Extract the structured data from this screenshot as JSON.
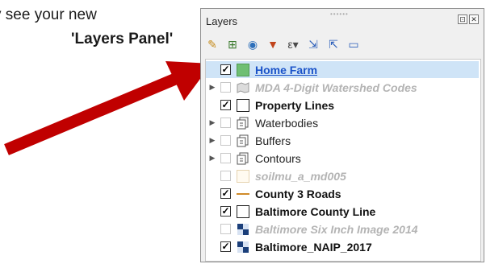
{
  "captions": {
    "line1": "y see your new",
    "line2": "'Layers Panel'"
  },
  "panel": {
    "title": "Layers",
    "titlebar_buttons": [
      "⊡",
      "✕"
    ],
    "toolbar": [
      {
        "icon": "paintbrush-icon",
        "glyph": "✎",
        "color": "#c58a18"
      },
      {
        "icon": "add-group-icon",
        "glyph": "⊞",
        "color": "#3a7a2c"
      },
      {
        "icon": "eye-icon",
        "glyph": "◉",
        "color": "#2d6fba"
      },
      {
        "icon": "filter-icon",
        "glyph": "▼",
        "color": "#c1441b"
      },
      {
        "icon": "filter-expression-icon",
        "glyph": "ε▾",
        "color": "#4b4b4b"
      },
      {
        "icon": "expand-all-icon",
        "glyph": "⇲",
        "color": "#2d5fba"
      },
      {
        "icon": "collapse-all-icon",
        "glyph": "⇱",
        "color": "#2d5fba"
      },
      {
        "icon": "remove-layer-icon",
        "glyph": "▭",
        "color": "#2d5fba"
      }
    ],
    "layers": [
      {
        "name": "Home Farm",
        "checked": true,
        "expand": false,
        "symbol": "green-fill",
        "style": "link",
        "selected": true
      },
      {
        "name": "MDA 4-Digit Watershed Codes",
        "checked": false,
        "expand": true,
        "symbol": "polygon-gray",
        "style": "dim",
        "selected": false
      },
      {
        "name": "Property Lines",
        "checked": true,
        "expand": false,
        "symbol": "white-box",
        "style": "bold",
        "selected": false
      },
      {
        "name": "Waterbodies",
        "checked": false,
        "expand": true,
        "symbol": "group",
        "style": "norm",
        "selected": false
      },
      {
        "name": "Buffers",
        "checked": false,
        "expand": true,
        "symbol": "group",
        "style": "norm",
        "selected": false
      },
      {
        "name": "Contours",
        "checked": false,
        "expand": true,
        "symbol": "group",
        "style": "norm",
        "selected": false
      },
      {
        "name": "soilmu_a_md005",
        "checked": false,
        "expand": false,
        "symbol": "pale-box",
        "style": "dim",
        "selected": false
      },
      {
        "name": "County 3 Roads",
        "checked": true,
        "expand": false,
        "symbol": "line-orange",
        "style": "bold",
        "selected": false
      },
      {
        "name": "Baltimore County Line",
        "checked": true,
        "expand": false,
        "symbol": "white-box",
        "style": "bold",
        "selected": false
      },
      {
        "name": "Baltimore Six Inch Image 2014",
        "checked": false,
        "expand": false,
        "symbol": "raster",
        "style": "dim",
        "selected": false
      },
      {
        "name": "Baltimore_NAIP_2017",
        "checked": true,
        "expand": false,
        "symbol": "raster",
        "style": "bold",
        "selected": false
      }
    ]
  },
  "colors": {
    "arrow": "#c00000",
    "selection": "#cfe4f7",
    "link": "#1a52c8",
    "home_farm_fill": "#6fbf73"
  }
}
